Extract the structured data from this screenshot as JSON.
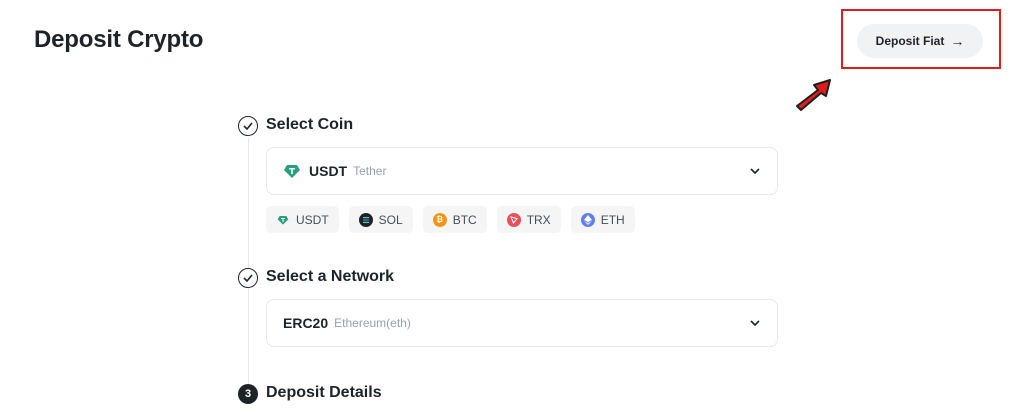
{
  "header": {
    "title": "Deposit Crypto",
    "deposit_fiat_label": "Deposit Fiat",
    "deposit_fiat_arrow": "→"
  },
  "steps": [
    {
      "title": "Select Coin",
      "state": "done"
    },
    {
      "title": "Select a Network",
      "state": "done"
    },
    {
      "title": "Deposit Details",
      "state": "current",
      "number": "3"
    }
  ],
  "coin_select": {
    "symbol": "USDT",
    "name": "Tether"
  },
  "coin_chips": [
    {
      "symbol": "USDT",
      "color": "#26a17b",
      "icon": "tether-icon"
    },
    {
      "symbol": "SOL",
      "color": "#1e2329",
      "icon": "solana-icon"
    },
    {
      "symbol": "BTC",
      "color": "#f7931a",
      "icon": "bitcoin-icon"
    },
    {
      "symbol": "TRX",
      "color": "#e8505b",
      "icon": "tron-icon"
    },
    {
      "symbol": "ETH",
      "color": "#627eea",
      "icon": "ethereum-icon"
    }
  ],
  "network_select": {
    "code": "ERC20",
    "name": "Ethereum(eth)"
  },
  "colors": {
    "highlight": "#e01b1b",
    "text": "#1e2329",
    "muted": "#9aa0a6"
  }
}
